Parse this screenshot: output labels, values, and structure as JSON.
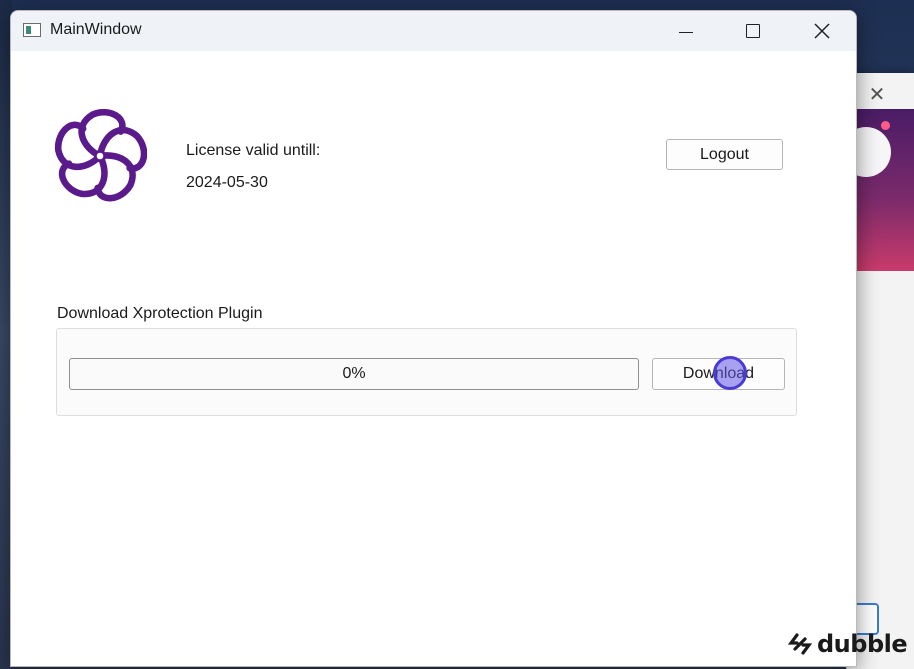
{
  "window": {
    "title": "MainWindow"
  },
  "license": {
    "label": "License valid untill:",
    "expiry_date": "2024-05-30"
  },
  "buttons": {
    "logout_label": "Logout",
    "download_label": "Download"
  },
  "download_section": {
    "title": "Download Xprotection Plugin",
    "progress_text": "0%",
    "progress_fraction": 0
  },
  "watermark": {
    "text": "dubble"
  },
  "icons": {
    "app": "window-app-icon",
    "logo": "purple-swirl-logo",
    "minimize": "minimize-icon",
    "maximize": "maximize-icon",
    "close": "close-icon"
  },
  "colors": {
    "logo": "#5b1a8b",
    "cursor": "#4a3ad6",
    "progress_fill": "#3b9a4a"
  }
}
